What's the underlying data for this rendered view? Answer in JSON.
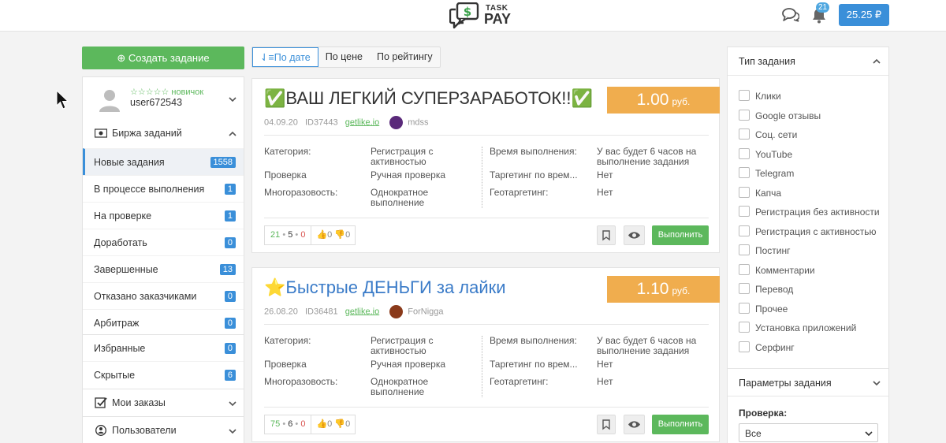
{
  "header": {
    "logo_top": "TASK",
    "logo_bottom": "PAY",
    "notif_count": "21",
    "balance": "25.25 ₽",
    "icons": {
      "chat": "chat-icon",
      "bell": "bell-icon"
    }
  },
  "create_button": "Создать задание",
  "sort": {
    "by_date": "По дате",
    "by_price": "По цене",
    "by_rating": "По рейтингу"
  },
  "sidebar": {
    "rank": "☆☆☆☆☆ новичок",
    "username": "user672543",
    "exchange_label": "Биржа заданий",
    "items": [
      {
        "label": "Новые задания",
        "count": "1558"
      },
      {
        "label": "В процессе выполнения",
        "count": "1"
      },
      {
        "label": "На проверке",
        "count": "1"
      },
      {
        "label": "Доработать",
        "count": "0"
      },
      {
        "label": "Завершенные",
        "count": "13"
      },
      {
        "label": "Отказано заказчиками",
        "count": "0"
      },
      {
        "label": "Арбитраж",
        "count": "0"
      },
      {
        "label": "Избранные",
        "count": "0"
      },
      {
        "label": "Скрытые",
        "count": "6"
      }
    ],
    "my_orders": "Мои заказы",
    "users": "Пользователи"
  },
  "tasks": [
    {
      "emoji_left": "✅",
      "title": "ВАШ ЛЕГКИЙ СУПЕРЗАРАБОТОК!!",
      "emoji_right": "✅",
      "price": "1.00",
      "currency": "руб.",
      "date": "04.09.20",
      "id": "ID37443",
      "site": "getlike.io",
      "author": "mdss",
      "labels": {
        "category": "Категория:",
        "check": "Проверка",
        "multi": "Многоразовость:",
        "time": "Время выполнения:",
        "targeting_time": "Таргетинг по врем...",
        "geo": "Геотаргетинг:"
      },
      "category": "Регистрация с активностью",
      "check": "Ручная проверка",
      "multi": "Однократное выполнение",
      "time": "У вас будет 6 часов на выполнение задания",
      "targeting_time": "Нет",
      "geo": "Нет",
      "stat_green": "21",
      "stat_mid": "5",
      "stat_red": "0",
      "likes": "0",
      "dislikes": "0",
      "action": "Выполнить"
    },
    {
      "emoji_left": "⭐",
      "title": "Быстрые ДЕНЬГИ за лайки",
      "emoji_right": "",
      "price": "1.10",
      "currency": "руб.",
      "date": "26.08.20",
      "id": "ID36481",
      "site": "getlike.io",
      "author": "ForNigga",
      "labels": {
        "category": "Категория:",
        "check": "Проверка",
        "multi": "Многоразовость:",
        "time": "Время выполнения:",
        "targeting_time": "Таргетинг по врем...",
        "geo": "Геотаргетинг:"
      },
      "category": "Регистрация с активностью",
      "check": "Ручная проверка",
      "multi": "Однократное выполнение",
      "time": "У вас будет 6 часов на выполнение задания",
      "targeting_time": "Нет",
      "geo": "Нет",
      "stat_green": "75",
      "stat_mid": "6",
      "stat_red": "0",
      "likes": "0",
      "dislikes": "0",
      "action": "Выполнить"
    }
  ],
  "filters": {
    "type_header": "Тип задания",
    "types": [
      "Клики",
      "Google отзывы",
      "Соц. сети",
      "YouTube",
      "Telegram",
      "Капча",
      "Регистрация без активности",
      "Регистрация с активностью",
      "Постинг",
      "Комментарии",
      "Перевод",
      "Прочее",
      "Установка приложений",
      "Серфинг"
    ],
    "params_header": "Параметры задания",
    "check_label": "Проверка:",
    "check_value": "Все"
  },
  "colors": {
    "accent": "#3a8fd9",
    "green": "#5cb85c",
    "price": "#f0ad4e"
  }
}
